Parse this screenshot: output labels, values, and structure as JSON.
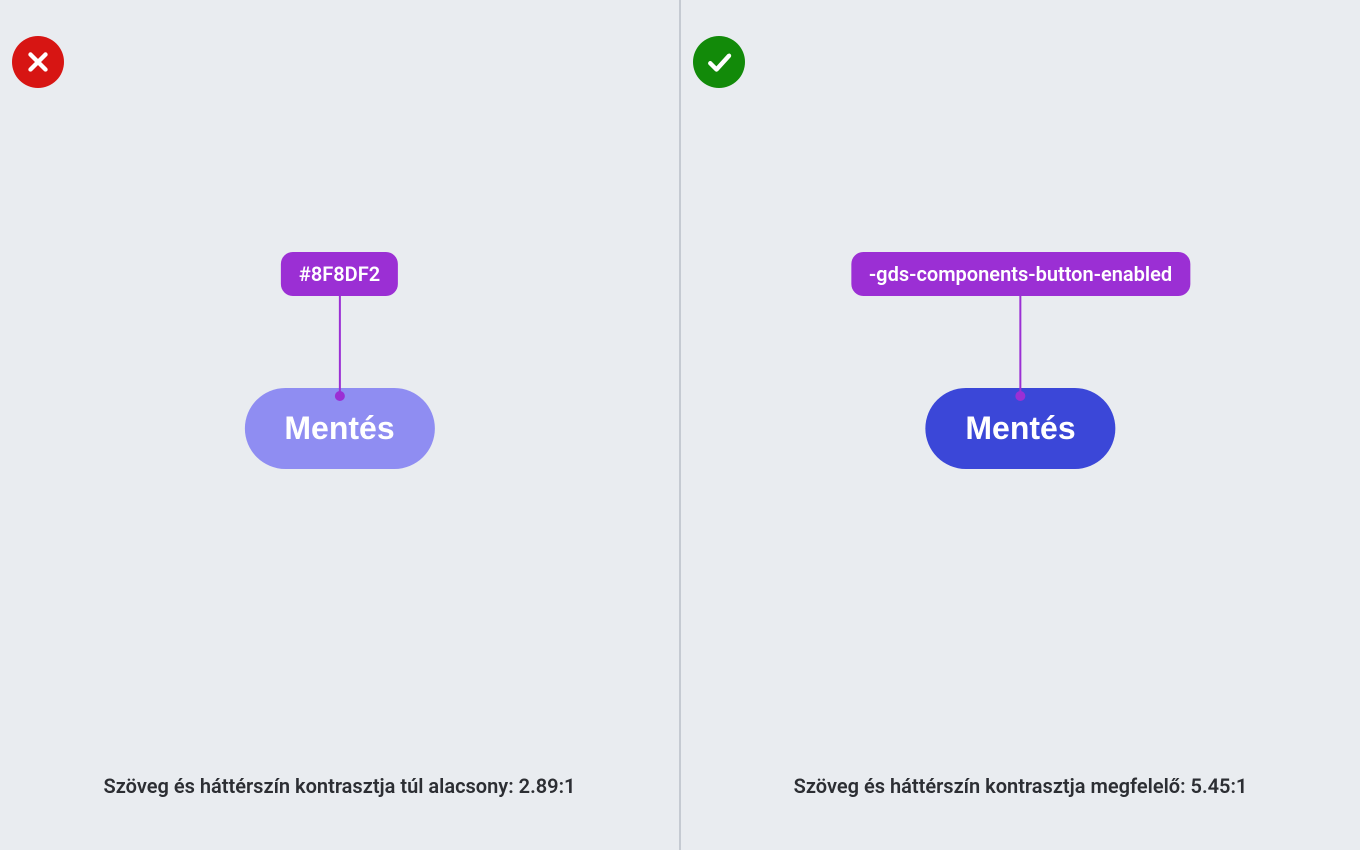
{
  "left": {
    "status": "error",
    "label_text": "#8F8DF2",
    "button_text": "Mentés",
    "button_bg": "#8F8DF2",
    "caption": "Szöveg és háttérszín kontrasztja túl alacsony: 2.89:1"
  },
  "right": {
    "status": "success",
    "label_text": "-gds-components-button-enabled",
    "button_text": "Mentés",
    "button_bg": "#3B47D8",
    "caption": "Szöveg és háttérszín kontrasztja megfelelő: 5.45:1"
  },
  "colors": {
    "error": "#d71513",
    "success": "#128a09",
    "label_bg": "#9b2fd4",
    "panel_bg": "#e9ecf0"
  }
}
